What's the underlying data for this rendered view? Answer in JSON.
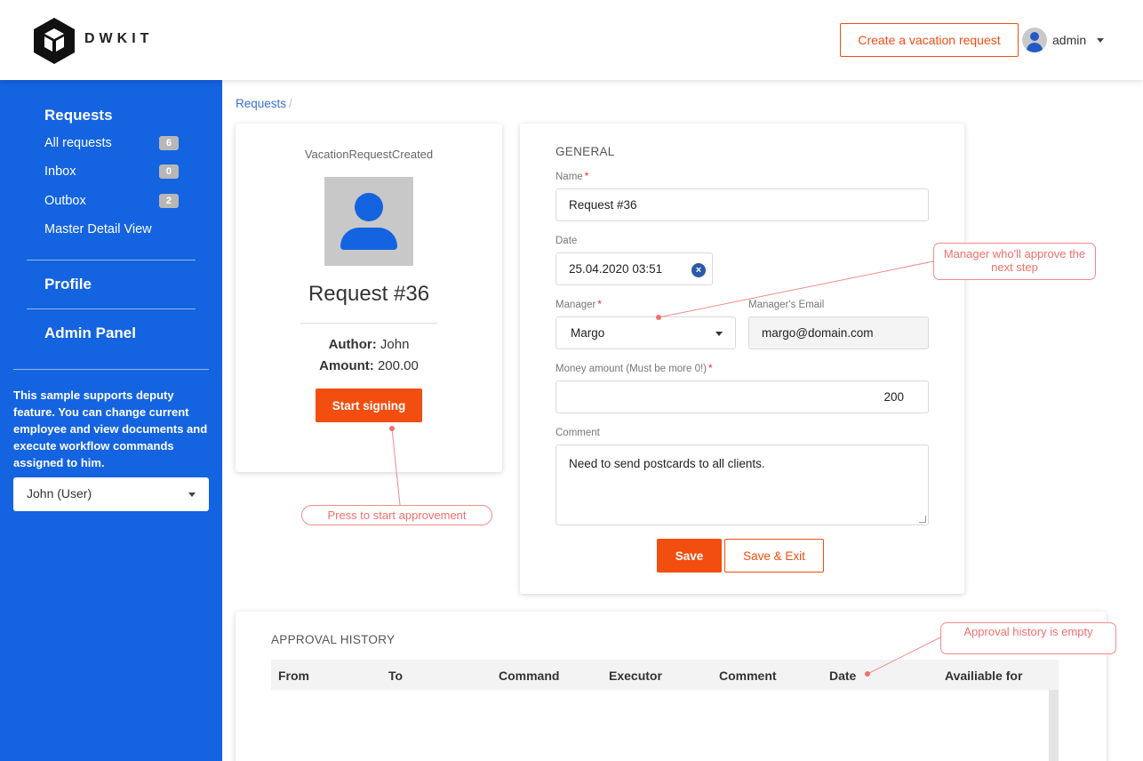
{
  "header": {
    "brand": "DWKIT",
    "create_button": "Create a vacation request",
    "user_name": "admin"
  },
  "sidebar": {
    "requests_heading": "Requests",
    "items": [
      {
        "label": "All requests",
        "count": "6"
      },
      {
        "label": "Inbox",
        "count": "0"
      },
      {
        "label": "Outbox",
        "count": "2"
      },
      {
        "label": "Master Detail View"
      }
    ],
    "profile": "Profile",
    "admin_panel": "Admin Panel",
    "note": "This sample supports deputy feature. You can change current employee and view documents and execute workflow commands assigned to him.",
    "employee_select": "John (User)"
  },
  "breadcrumb": {
    "item": "Requests",
    "separator": "/"
  },
  "summary_card": {
    "state": "VacationRequestCreated",
    "title": "Request #36",
    "author_label": "Author:",
    "author": "John",
    "amount_label": "Amount:",
    "amount": "200.00",
    "start_button": "Start signing"
  },
  "form": {
    "section_title": "GENERAL",
    "name_label": "Name",
    "name_value": "Request #36",
    "date_label": "Date",
    "date_value": "25.04.2020 03:51",
    "manager_label": "Manager",
    "manager_value": "Margo",
    "email_label": "Manager's Email",
    "email_value": "margo@domain.com",
    "amount_label": "Money amount (Must be more 0!)",
    "amount_value": "200",
    "comment_label": "Comment",
    "comment_value": "Need to send postcards to all clients.",
    "save_button": "Save",
    "save_exit_button": "Save & Exit",
    "required_mark": "*",
    "clear_icon": "×"
  },
  "history": {
    "title": "APPROVAL HISTORY",
    "columns": [
      "From",
      "To",
      "Command",
      "Executor",
      "Comment",
      "Date",
      "Availiable for"
    ]
  },
  "annotations": {
    "manager_note": "Manager who'll approve the next step",
    "start_note": "Press to start approvement",
    "history_note": "Approval history is empty"
  },
  "colors": {
    "sidebar_blue": "#1463e0",
    "accent_orange": "#f24e0f",
    "annotation_red": "#f0706d"
  },
  "icons": [
    "logo-cube-icon",
    "user-avatar-icon",
    "chevron-down-icon",
    "clear-date-icon",
    "employee-photo-icon"
  ]
}
